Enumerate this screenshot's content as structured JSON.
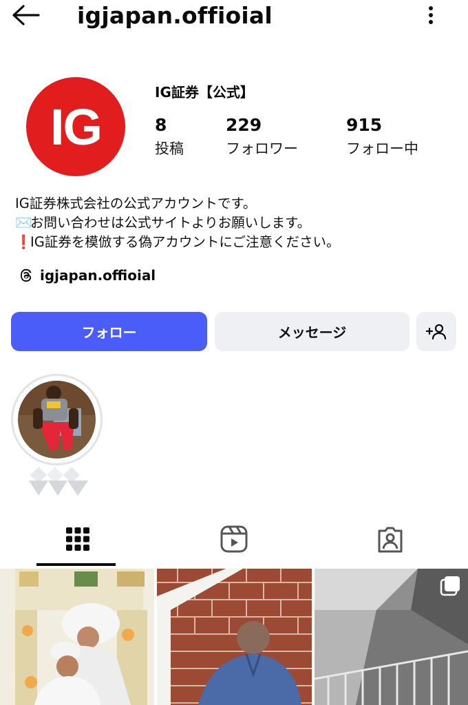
{
  "header": {
    "username": "igjapan.offioial",
    "back_icon": "arrow-left-icon",
    "more_icon": "more-vertical-icon"
  },
  "profile": {
    "avatar_text": "IG",
    "avatar_color": "#e11d1d",
    "display_name": "IG証券【公式】",
    "stats": [
      {
        "value": "8",
        "label": "投稿"
      },
      {
        "value": "229",
        "label": "フォロワー"
      },
      {
        "value": "915",
        "label": "フォロー中"
      }
    ],
    "bio": [
      {
        "emoji": "",
        "text": "IG証券株式会社の公式アカウントです。"
      },
      {
        "emoji": "✉️",
        "text": "お問い合わせは公式サイトよりお願いします。"
      },
      {
        "emoji": "❗",
        "text": "IG証券を模倣する偽アカウントにご注意ください。"
      }
    ],
    "threads_handle": "igjapan.offioial"
  },
  "actions": {
    "follow_label": "フォロー",
    "message_label": "メッセージ",
    "follow_color": "#4a5df9",
    "suggest_icon": "add-person-icon"
  },
  "tabs": [
    {
      "name": "posts",
      "icon": "grid-icon",
      "active": true
    },
    {
      "name": "reels",
      "icon": "reels-icon",
      "active": false
    },
    {
      "name": "tagged",
      "icon": "tagged-person-icon",
      "active": false
    }
  ],
  "grid": [
    {
      "icon": ""
    },
    {
      "icon": ""
    },
    {
      "icon": "multi-post-icon"
    }
  ]
}
